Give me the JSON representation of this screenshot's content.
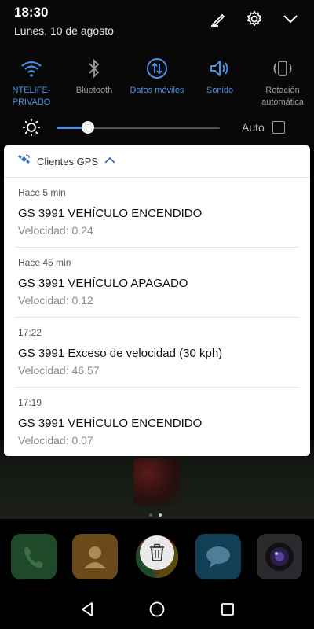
{
  "status_bar": {
    "time": "18:30",
    "date": "Lunes, 10 de agosto"
  },
  "header_icons": [
    "edit-icon",
    "settings-icon",
    "chevron-down-icon"
  ],
  "quick_tiles": [
    {
      "id": "wifi",
      "label_line1": "NTELIFE-",
      "label_line2": "PRIVADO",
      "active": true,
      "icon": "wifi-icon"
    },
    {
      "id": "bluetooth",
      "label_line1": "Bluetooth",
      "label_line2": "",
      "active": false,
      "icon": "bluetooth-icon"
    },
    {
      "id": "mobile-data",
      "label_line1": "Datos móviles",
      "label_line2": "",
      "active": true,
      "icon": "mobile-data-icon"
    },
    {
      "id": "sound",
      "label_line1": "Sonido",
      "label_line2": "",
      "active": true,
      "icon": "sound-icon"
    },
    {
      "id": "rotation",
      "label_line1": "Rotación",
      "label_line2": "automática",
      "active": false,
      "icon": "rotation-icon"
    }
  ],
  "brightness": {
    "level": 0.19,
    "auto_label": "Auto",
    "auto_checked": false
  },
  "notification_group": {
    "app_name": "Clientes GPS",
    "items": [
      {
        "time": "Hace 5 min",
        "title": "GS 3991 VEHÍCULO ENCENDIDO",
        "text": "Velocidad: 0.24"
      },
      {
        "time": "Hace 45 min",
        "title": "GS 3991 VEHÍCULO APAGADO",
        "text": "Velocidad: 0.12"
      },
      {
        "time": "17:22",
        "title": "GS 3991 Exceso de velocidad (30 kph)",
        "text": "Velocidad: 46.57"
      },
      {
        "time": "17:19",
        "title": "GS 3991 VEHÍCULO ENCENDIDO",
        "text": "Velocidad: 0.07"
      }
    ]
  },
  "colors": {
    "accent": "#4a8fe0",
    "card_bg": "#ffffff",
    "shade_bg": "#080808"
  },
  "dock": [
    "phone-app-icon",
    "contacts-app-icon",
    "chrome-app-icon",
    "messages-app-icon",
    "camera-app-icon"
  ],
  "navigation": [
    "back-icon",
    "home-icon",
    "recents-icon"
  ]
}
